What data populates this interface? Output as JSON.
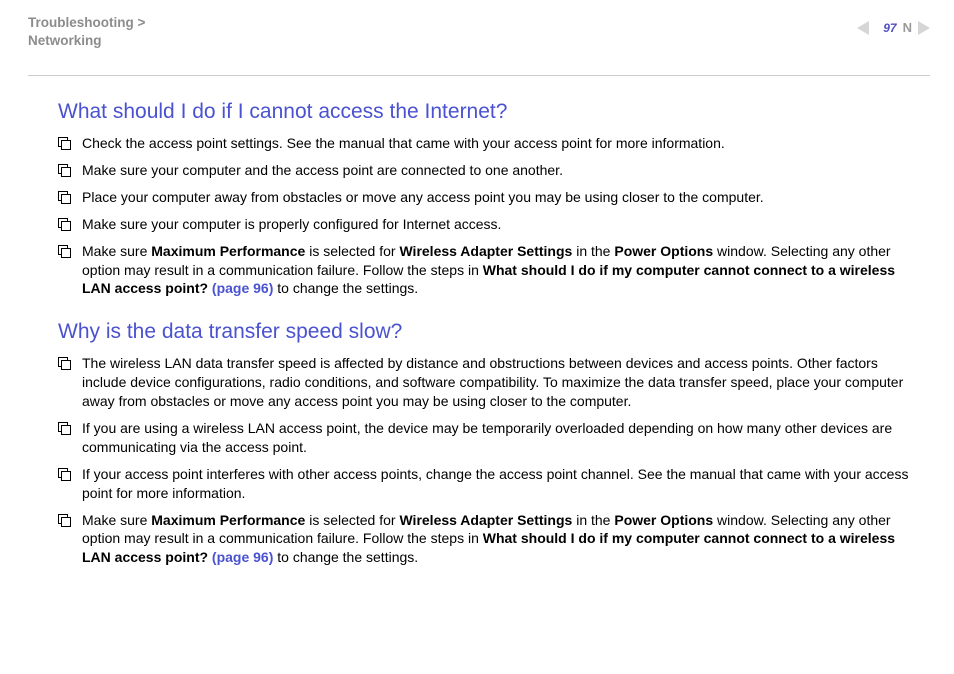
{
  "header": {
    "breadcrumb_line1": "Troubleshooting >",
    "breadcrumb_line2": "Networking",
    "page_number": "97",
    "n_label": "N"
  },
  "sections": [
    {
      "title": "What should I do if I cannot access the Internet?",
      "items": [
        {
          "html": "Check the access point settings. See the manual that came with your access point for more information."
        },
        {
          "html": "Make sure your computer and the access point are connected to one another."
        },
        {
          "html": "Place your computer away from obstacles or move any access point you may be using closer to the computer."
        },
        {
          "html": "Make sure your computer is properly configured for Internet access."
        },
        {
          "html": "Make sure <b>Maximum Performance</b> is selected for <b>Wireless Adapter Settings</b> in the <b>Power Options</b> window. Selecting any other option may result in a communication failure. Follow the steps in <b>What should I do if my computer cannot connect to a wireless LAN access point? <span class=\"link\">(page 96)</span></b> to change the settings."
        }
      ]
    },
    {
      "title": "Why is the data transfer speed slow?",
      "items": [
        {
          "html": "The wireless LAN data transfer speed is affected by distance and obstructions between devices and access points. Other factors include device configurations, radio conditions, and software compatibility. To maximize the data transfer speed, place your computer away from obstacles or move any access point you may be using closer to the computer."
        },
        {
          "html": "If you are using a wireless LAN access point, the device may be temporarily overloaded depending on how many other devices are communicating via the access point."
        },
        {
          "html": "If your access point interferes with other access points, change the access point channel. See the manual that came with your access point for more information."
        },
        {
          "html": "Make sure <b>Maximum Performance</b> is selected for <b>Wireless Adapter Settings</b> in the <b>Power Options</b> window. Selecting any other option may result in a communication failure. Follow the steps in <b>What should I do if my computer cannot connect to a wireless LAN access point? <span class=\"link\">(page 96)</span></b> to change the settings."
        }
      ]
    }
  ]
}
